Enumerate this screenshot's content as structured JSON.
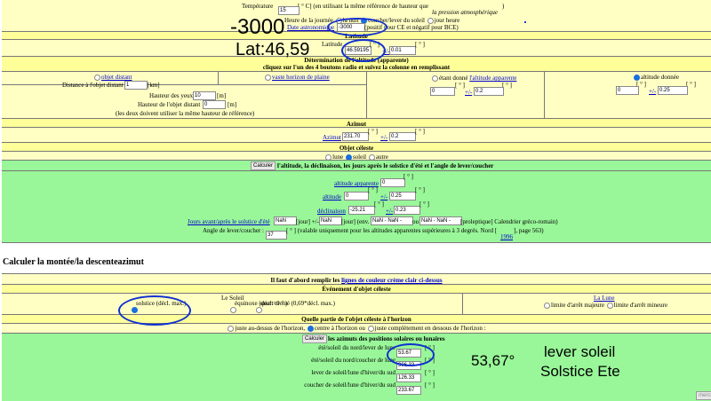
{
  "top": {
    "temperature_label": "Température",
    "temperature_unit": "[ ° C] (en utilisant la même référence de hauteur que",
    "temperature_close": ")",
    "pressure_note": "la pression atmosphérique",
    "temperature_value": "15",
    "heure_label": "Heure de la journée",
    "heure_options": [
      "la nuit",
      "coucher/lever du soleil",
      "jour heure"
    ],
    "heure_selected": 1,
    "date_link": "Date astronomique",
    "date_value": "-3000",
    "date_note": "(positif pour CE et négatif pour BCE)"
  },
  "latitude": {
    "header": "Latitude",
    "label": "Latitude",
    "unit": "[ ° ]",
    "pm": "+/-",
    "value": "46.59195",
    "tolerance": "0.01",
    "unit2": "[ ° ]"
  },
  "altitude_det": {
    "header1": "Détermination de l'altitude (apparente)",
    "header2": "cliquez sur l'un des 4 boutons radio et suivez la colonne en remplissant",
    "objet_distant": "objet distant",
    "distance_label": "Distance à l'objet distant",
    "distance_value": "1",
    "distance_unit": "[km]",
    "horizon_plaine": "vaste horizon de plaine",
    "eye_label": "Hauteur des yeux",
    "eye_value": "10",
    "eye_unit": "[m]",
    "obj_height_label": "Hauteur de l'objet distant",
    "obj_height_value": "0",
    "obj_height_unit": "[m]",
    "note": "(les deux doivent utiliser la même hauteur de référence)",
    "etant_donne": "étant donné",
    "altitude_apparente": "l'altitude apparente",
    "app_value": "0",
    "app_tol": "0.2",
    "altitude_donnee": "altitude donnée",
    "given_value": "0",
    "given_tol": "0.25",
    "unit": "[ ° ]",
    "pm": "+/-"
  },
  "azimut": {
    "header": "Azimut",
    "link": "Azimut",
    "value": "231.70",
    "tolerance": "0.2",
    "unit": "[ ° ]",
    "pm": "+/-"
  },
  "objet": {
    "header": "Objet céleste",
    "options": [
      "lune",
      "soleil",
      "autre"
    ],
    "selected": 1
  },
  "calc1": {
    "button": "Calculer",
    "text": "l'altitude, la déclinaison, les jours après le solstice d'été et l'angle de lever/coucher",
    "alt_app_link": "altitude apparente",
    "alt_app_value": "0",
    "alt_link": "altitude",
    "alt_value": "0",
    "alt_tol": "0.25",
    "decl_link": "déclinaison",
    "decl_value": "-25.21",
    "decl_tol": "0.23",
    "unit": "[ ° ]",
    "pm": "+/-",
    "jours_link": "Jours avant/après le solstice d'été",
    "jours_value": "NaN",
    "jour_unit": "[jour] +/-",
    "jours_tol": "NaN",
    "jour_unit2": "[jour] (env.",
    "date1": "NaN - NaN - NaN",
    "ou": "ou",
    "date2": "NaN - NaN - NaN",
    "calendar": "[proleptique] Calendrier gréco-romain)",
    "angle_label": "Angle de lever/coucher :",
    "angle_value": "37",
    "angle_note": "[ ° ] (valable uniquement pour les altitudes apparentes supérieures à 3 degrés. Nord [",
    "nord_link": "1996",
    "page_note": "], page 563)"
  },
  "section2": {
    "title": "Calculer la montée/la descenteazimut",
    "fill_text": "Il faut d'abord remplir les",
    "fill_link": "lignes de couleur crème clair ci-dessus",
    "event_header": "Événement d'objet céleste",
    "soleil_label": "Le Soleil",
    "soleil_options": [
      "solstice (décl. max.)",
      "équinoxe (décl.=0 ° )",
      "quart croisé (0,69*décl. max.)"
    ],
    "soleil_selected": 0,
    "lune_link": "La Lune",
    "lune_options": [
      "limite d'arrêt majeure",
      "limite d'arrêt mineure"
    ],
    "horizon_header": "Quelle partie de l'objet céleste à l'horizon",
    "horizon_options": [
      "juste au-dessus de l'horizon,",
      "centre à l'horizon ou",
      "juste complètement en dessous de l'horizon :"
    ],
    "horizon_selected": 1,
    "button": "Calculer",
    "calc_text": "les azimuts des positions solaires ou lunaires",
    "results": [
      {
        "label": "été/soleil du nord/lever de lune",
        "value": "53.67"
      },
      {
        "label": "été/soleil du nord/coucher de lune",
        "value": "306.33"
      },
      {
        "label": "lever de soleil/lune d'hiver/du sud",
        "value": "126.33"
      },
      {
        "label": "coucher de soleil/lune d'hiver/du sud",
        "value": "233.67"
      }
    ],
    "unit": "[ ° ]",
    "corner_button": "mercr"
  },
  "annotations": {
    "date": "-3000",
    "lat": "Lat:46,59",
    "azimuth": "53,67°",
    "line1": "lever soleil",
    "line2": "Solstice Ete",
    "color": "#1030d0"
  }
}
